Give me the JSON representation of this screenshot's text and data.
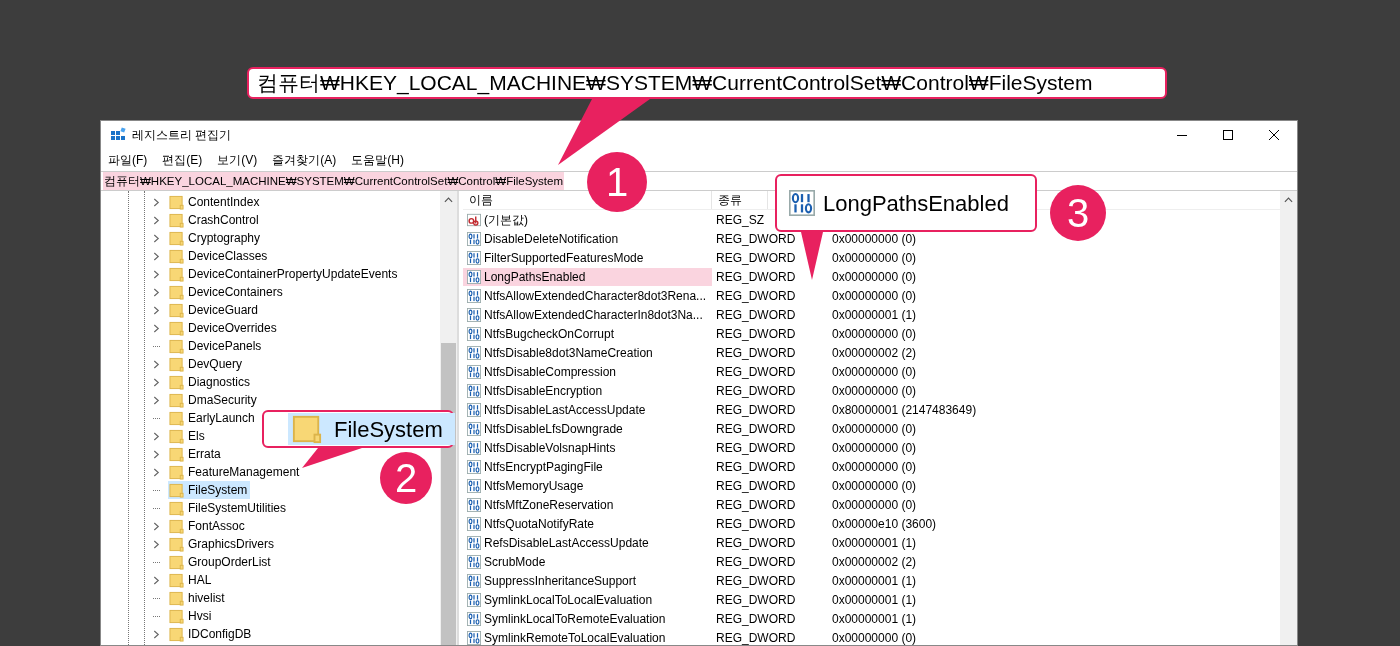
{
  "window": {
    "title": "레지스트리 편집기"
  },
  "menu": [
    "파일(F)",
    "편집(E)",
    "보기(V)",
    "즐겨찾기(A)",
    "도움말(H)"
  ],
  "address": "컴퓨터₩HKEY_LOCAL_MACHINE₩SYSTEM₩CurrentControlSet₩Control₩FileSystem",
  "tree": {
    "items": [
      {
        "label": "ContentIndex",
        "expandable": true,
        "selected": false
      },
      {
        "label": "CrashControl",
        "expandable": true,
        "selected": false
      },
      {
        "label": "Cryptography",
        "expandable": true,
        "selected": false
      },
      {
        "label": "DeviceClasses",
        "expandable": true,
        "selected": false
      },
      {
        "label": "DeviceContainerPropertyUpdateEvents",
        "expandable": true,
        "selected": false
      },
      {
        "label": "DeviceContainers",
        "expandable": true,
        "selected": false
      },
      {
        "label": "DeviceGuard",
        "expandable": true,
        "selected": false
      },
      {
        "label": "DeviceOverrides",
        "expandable": true,
        "selected": false
      },
      {
        "label": "DevicePanels",
        "expandable": false,
        "selected": false
      },
      {
        "label": "DevQuery",
        "expandable": true,
        "selected": false
      },
      {
        "label": "Diagnostics",
        "expandable": true,
        "selected": false
      },
      {
        "label": "DmaSecurity",
        "expandable": true,
        "selected": false
      },
      {
        "label": "EarlyLaunch",
        "expandable": false,
        "selected": false
      },
      {
        "label": "Els",
        "expandable": true,
        "selected": false
      },
      {
        "label": "Errata",
        "expandable": true,
        "selected": false
      },
      {
        "label": "FeatureManagement",
        "expandable": true,
        "selected": false
      },
      {
        "label": "FileSystem",
        "expandable": false,
        "selected": true
      },
      {
        "label": "FileSystemUtilities",
        "expandable": false,
        "selected": false
      },
      {
        "label": "FontAssoc",
        "expandable": true,
        "selected": false
      },
      {
        "label": "GraphicsDrivers",
        "expandable": true,
        "selected": false
      },
      {
        "label": "GroupOrderList",
        "expandable": false,
        "selected": false
      },
      {
        "label": "HAL",
        "expandable": true,
        "selected": false
      },
      {
        "label": "hivelist",
        "expandable": false,
        "selected": false
      },
      {
        "label": "Hvsi",
        "expandable": false,
        "selected": false
      },
      {
        "label": "IDConfigDB",
        "expandable": true,
        "selected": false
      }
    ]
  },
  "values": {
    "columns": [
      "이름",
      "종류"
    ],
    "rows": [
      {
        "kind": "string",
        "name": "(기본값)",
        "type": "REG_SZ",
        "highlighted": false
      },
      {
        "kind": "dword",
        "name": "DisableDeleteNotification",
        "type": "REG_DWORD",
        "data": "0x00000000 (0)",
        "highlighted": false
      },
      {
        "kind": "dword",
        "name": "FilterSupportedFeaturesMode",
        "type": "REG_DWORD",
        "data": "0x00000000 (0)",
        "highlighted": false
      },
      {
        "kind": "dword",
        "name": "LongPathsEnabled",
        "type": "REG_DWORD",
        "data": "0x00000000 (0)",
        "highlighted": true
      },
      {
        "kind": "dword",
        "name": "NtfsAllowExtendedCharacter8dot3Rena...",
        "type": "REG_DWORD",
        "data": "0x00000000 (0)",
        "highlighted": false
      },
      {
        "kind": "dword",
        "name": "NtfsAllowExtendedCharacterIn8dot3Na...",
        "type": "REG_DWORD",
        "data": "0x00000001 (1)",
        "highlighted": false
      },
      {
        "kind": "dword",
        "name": "NtfsBugcheckOnCorrupt",
        "type": "REG_DWORD",
        "data": "0x00000000 (0)",
        "highlighted": false
      },
      {
        "kind": "dword",
        "name": "NtfsDisable8dot3NameCreation",
        "type": "REG_DWORD",
        "data": "0x00000002 (2)",
        "highlighted": false
      },
      {
        "kind": "dword",
        "name": "NtfsDisableCompression",
        "type": "REG_DWORD",
        "data": "0x00000000 (0)",
        "highlighted": false
      },
      {
        "kind": "dword",
        "name": "NtfsDisableEncryption",
        "type": "REG_DWORD",
        "data": "0x00000000 (0)",
        "highlighted": false
      },
      {
        "kind": "dword",
        "name": "NtfsDisableLastAccessUpdate",
        "type": "REG_DWORD",
        "data": "0x80000001 (2147483649)",
        "highlighted": false
      },
      {
        "kind": "dword",
        "name": "NtfsDisableLfsDowngrade",
        "type": "REG_DWORD",
        "data": "0x00000000 (0)",
        "highlighted": false
      },
      {
        "kind": "dword",
        "name": "NtfsDisableVolsnapHints",
        "type": "REG_DWORD",
        "data": "0x00000000 (0)",
        "highlighted": false
      },
      {
        "kind": "dword",
        "name": "NtfsEncryptPagingFile",
        "type": "REG_DWORD",
        "data": "0x00000000 (0)",
        "highlighted": false
      },
      {
        "kind": "dword",
        "name": "NtfsMemoryUsage",
        "type": "REG_DWORD",
        "data": "0x00000000 (0)",
        "highlighted": false
      },
      {
        "kind": "dword",
        "name": "NtfsMftZoneReservation",
        "type": "REG_DWORD",
        "data": "0x00000000 (0)",
        "highlighted": false
      },
      {
        "kind": "dword",
        "name": "NtfsQuotaNotifyRate",
        "type": "REG_DWORD",
        "data": "0x00000e10 (3600)",
        "highlighted": false
      },
      {
        "kind": "dword",
        "name": "RefsDisableLastAccessUpdate",
        "type": "REG_DWORD",
        "data": "0x00000001 (1)",
        "highlighted": false
      },
      {
        "kind": "dword",
        "name": "ScrubMode",
        "type": "REG_DWORD",
        "data": "0x00000002 (2)",
        "highlighted": false
      },
      {
        "kind": "dword",
        "name": "SuppressInheritanceSupport",
        "type": "REG_DWORD",
        "data": "0x00000001 (1)",
        "highlighted": false
      },
      {
        "kind": "dword",
        "name": "SymlinkLocalToLocalEvaluation",
        "type": "REG_DWORD",
        "data": "0x00000001 (1)",
        "highlighted": false
      },
      {
        "kind": "dword",
        "name": "SymlinkLocalToRemoteEvaluation",
        "type": "REG_DWORD",
        "data": "0x00000001 (1)",
        "highlighted": false
      },
      {
        "kind": "dword",
        "name": "SymlinkRemoteToLocalEvaluation",
        "type": "REG_DWORD",
        "data": "0x00000000 (0)",
        "highlighted": false
      }
    ]
  },
  "callouts": [
    {
      "kind": "path",
      "number": "1",
      "text": "컴퓨터₩HKEY_LOCAL_MACHINE₩SYSTEM₩CurrentControlSet₩Control₩FileSystem"
    },
    {
      "kind": "folder",
      "number": "2",
      "text": "FileSystem"
    },
    {
      "kind": "value",
      "number": "3",
      "text": "LongPathsEnabled"
    }
  ]
}
